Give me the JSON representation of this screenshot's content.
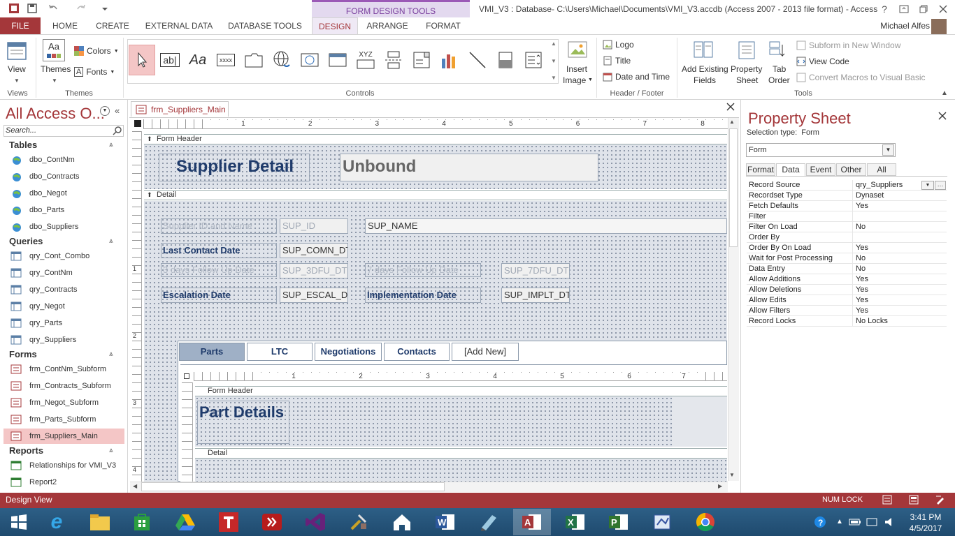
{
  "window": {
    "title": "VMI_V3 : Database- C:\\Users\\Michael\\Documents\\VMI_V3.accdb (Access 2007 - 2013 file format) - Access",
    "contextual_group": "FORM DESIGN TOOLS",
    "help_glyph": "?",
    "user": "Michael Alfes"
  },
  "tabs": {
    "file": "FILE",
    "items": [
      "HOME",
      "CREATE",
      "EXTERNAL DATA",
      "DATABASE TOOLS",
      "DESIGN",
      "ARRANGE",
      "FORMAT"
    ],
    "active": "DESIGN"
  },
  "ribbon": {
    "views": {
      "group": "Views",
      "view": "View"
    },
    "themes": {
      "group": "Themes",
      "themes": "Themes",
      "colors": "Colors",
      "fonts": "Fonts"
    },
    "controls": {
      "group": "Controls",
      "label_glyph": "Aa",
      "textbox_glyph": "ab|",
      "hyperlink_glyph": "xxxx",
      "option_glyph": "XYZ"
    },
    "insert_image": {
      "line1": "Insert",
      "line2": "Image"
    },
    "header_footer": {
      "group": "Header / Footer",
      "logo": "Logo",
      "title": "Title",
      "date_time": "Date and Time"
    },
    "tools": {
      "group": "Tools",
      "add_existing_l1": "Add Existing",
      "add_existing_l2": "Fields",
      "property_l1": "Property",
      "property_l2": "Sheet",
      "tab_l1": "Tab",
      "tab_l2": "Order",
      "subform_new_window": "Subform in New Window",
      "view_code": "View Code",
      "convert_macros": "Convert Macros to Visual Basic"
    }
  },
  "nav": {
    "title": "All Access O...",
    "search_placeholder": "Search...",
    "tables_label": "Tables",
    "tables": [
      "dbo_ContNm",
      "dbo_Contracts",
      "dbo_Negot",
      "dbo_Parts",
      "dbo_Suppliers"
    ],
    "queries_label": "Queries",
    "queries": [
      "qry_Cont_Combo",
      "qry_ContNm",
      "qry_Contracts",
      "qry_Negot",
      "qry_Parts",
      "qry_Suppliers"
    ],
    "forms_label": "Forms",
    "forms": [
      "frm_ContNm_Subform",
      "frm_Contracts_Subform",
      "frm_Negot_Subform",
      "frm_Parts_Subform",
      "frm_Suppliers_Main"
    ],
    "selected_form": "frm_Suppliers_Main",
    "reports_label": "Reports",
    "reports": [
      "Relationships for VMI_V3",
      "Report2"
    ]
  },
  "document": {
    "tab_title": "frm_Suppliers_Main",
    "ruler_numbers": [
      "1",
      "2",
      "3",
      "4",
      "5",
      "6",
      "7",
      "8"
    ],
    "vruler_numbers": [
      "1",
      "2",
      "3",
      "4"
    ],
    "form_header_label": "Form Header",
    "header_title": "Supplier Detail",
    "header_unbound": "Unbound",
    "detail_label": "Detail",
    "labels": {
      "id_name": "Supplier ID and Name",
      "last_contact": "Last Contact Date",
      "follow3": "3 days Follow Up Date",
      "follow7": "7 days Follow Up Date",
      "escalation": "Escalation Date",
      "implementation": "Implementation Date"
    },
    "fields": {
      "sup_id": "SUP_ID",
      "sup_name": "SUP_NAME",
      "comn": "SUP_COMN_DT",
      "dfu3": "SUP_3DFU_DT",
      "dfu7": "SUP_7DFU_DT",
      "escal": "SUP_ESCAL_DT",
      "implt": "SUP_IMPLT_DT"
    },
    "subtabs": [
      "Parts",
      "LTC",
      "Negotiations",
      "Contacts",
      "[Add New]"
    ],
    "subform_ruler_numbers": [
      "1",
      "2",
      "3",
      "4",
      "5",
      "6",
      "7"
    ],
    "subform": {
      "form_header_label": "Form Header",
      "title": "Part Details",
      "detail_label": "Detail"
    }
  },
  "property_sheet": {
    "title": "Property Sheet",
    "selection_type": "Selection type:  Form",
    "object": "Form",
    "tabs": [
      "Format",
      "Data",
      "Event",
      "Other",
      "All"
    ],
    "active_tab": "Data",
    "rows": [
      {
        "name": "Record Source",
        "value": "qry_Suppliers"
      },
      {
        "name": "Recordset Type",
        "value": "Dynaset"
      },
      {
        "name": "Fetch Defaults",
        "value": "Yes"
      },
      {
        "name": "Filter",
        "value": ""
      },
      {
        "name": "Filter On Load",
        "value": "No"
      },
      {
        "name": "Order By",
        "value": ""
      },
      {
        "name": "Order By On Load",
        "value": "Yes"
      },
      {
        "name": "Wait for Post Processing",
        "value": "No"
      },
      {
        "name": "Data Entry",
        "value": "No"
      },
      {
        "name": "Allow Additions",
        "value": "Yes"
      },
      {
        "name": "Allow Deletions",
        "value": "Yes"
      },
      {
        "name": "Allow Edits",
        "value": "Yes"
      },
      {
        "name": "Allow Filters",
        "value": "Yes"
      },
      {
        "name": "Record Locks",
        "value": "No Locks"
      }
    ]
  },
  "status": {
    "mode": "Design View",
    "num_lock": "NUM LOCK"
  },
  "taskbar": {
    "time": "3:41 PM",
    "date": "4/5/2017",
    "ie_glyph": "e",
    "access_glyph": "A",
    "word_glyph": "W",
    "excel_glyph": "X",
    "project_glyph": "P"
  },
  "colors": {
    "accent": "#a4373a",
    "contextual": "#9b59b6",
    "grid": "#dfe3ea",
    "label_text": "#1f3b6b"
  }
}
